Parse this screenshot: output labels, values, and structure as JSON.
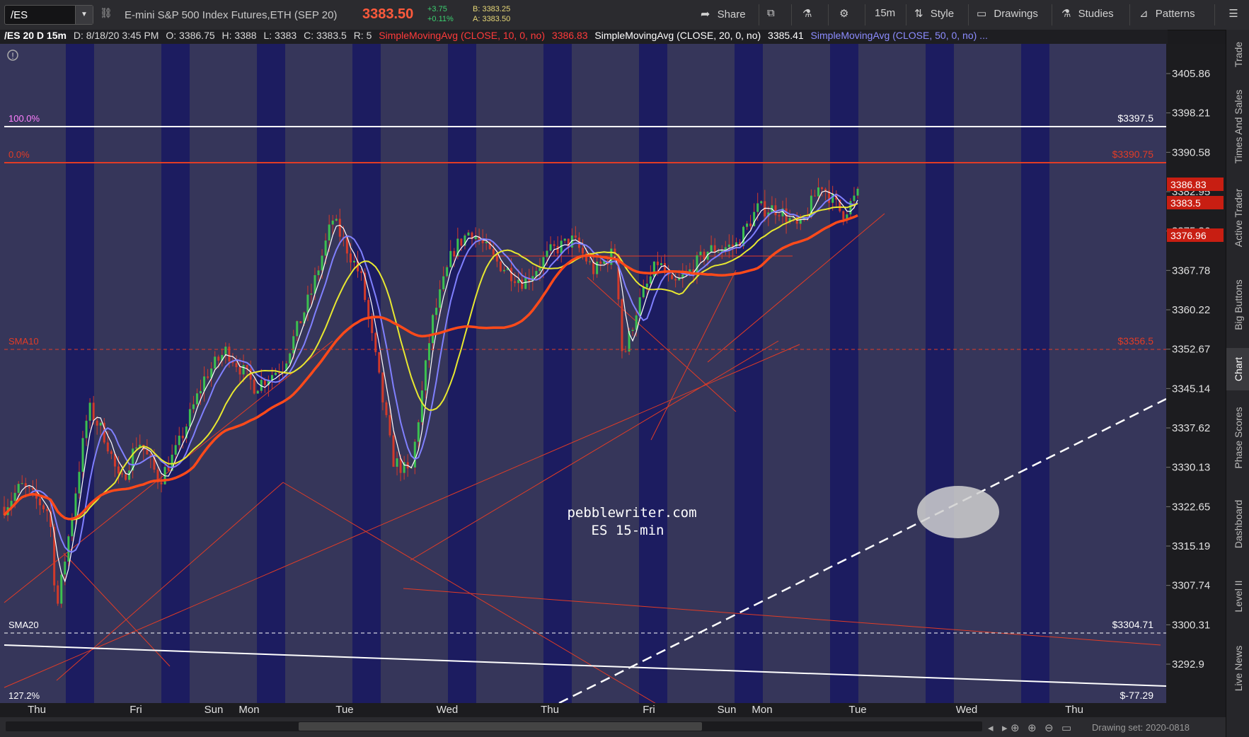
{
  "toolbar": {
    "symbol": "/ES",
    "title": "E-mini S&P 500 Index Futures,ETH (SEP 20)",
    "last_price": "3383.50",
    "change": "+3.75",
    "change_pct": "+0.11%",
    "bid": "B: 3383.25",
    "ask": "A: 3383.50",
    "share": "Share",
    "timeframe": "15m",
    "style": "Style",
    "drawings": "Drawings",
    "studies": "Studies",
    "patterns": "Patterns"
  },
  "header": {
    "symbol_info": "/ES 20 D 15m",
    "date": "D: 8/18/20 3:45 PM",
    "open": "O: 3386.75",
    "high": "H: 3388",
    "low": "L: 3383",
    "close": "C: 3383.5",
    "range": "R: 5",
    "sma10_label": "SimpleMovingAvg (CLOSE, 10, 0, no)",
    "sma10_value": "3386.83",
    "sma20_label": "SimpleMovingAvg (CLOSE, 20, 0, no)",
    "sma20_value": "3385.41",
    "sma50_label": "SimpleMovingAvg (CLOSE, 50, 0, no) ..."
  },
  "colors": {
    "background": "#36365a",
    "session_band": "#1c1c60",
    "candle": "#d23a2a",
    "sma10": "#ffffff",
    "sma20": "#8080ff",
    "sma50": "#e8e830",
    "ema": "#ff4a1a",
    "fib_red": "#e23c26",
    "accent": "#ff5a3c"
  },
  "chart_labels": {
    "fib_100": "100.0%",
    "fib_100_price": "$3397.5",
    "fib_0": "0.0%",
    "fib_0_price": "$3390.75",
    "sma10_line": "SMA10",
    "sma10_line_price": "$3356.5",
    "sma20_line": "SMA20",
    "sma20_line_price": "$3304.71",
    "fib_127": "127.2%",
    "fib_127_price": "$-77.29",
    "watermark_1": "pebblewriter.com",
    "watermark_2": "ES 15-min"
  },
  "price_axis": {
    "ticks": [
      "3405.86",
      "3398.21",
      "3390.58",
      "3382.95",
      "3375.36",
      "3367.78",
      "3360.22",
      "3352.67",
      "3345.14",
      "3337.62",
      "3330.13",
      "3322.65",
      "3315.19",
      "3307.74",
      "3300.31",
      "3292.9"
    ],
    "badges": [
      "3386.83",
      "3383.5",
      "3376.96"
    ]
  },
  "time_axis": {
    "labels": [
      "Thu",
      "Fri",
      "Sun",
      "Mon",
      "Tue",
      "Wed",
      "Thu",
      "Fri",
      "Sun",
      "Mon",
      "Tue",
      "Wed",
      "Thu"
    ]
  },
  "right_tabs": [
    "Trade",
    "Times And Sales",
    "Active Trader",
    "Big Buttons",
    "Chart",
    "Phase Scores",
    "Dashboard",
    "Level II",
    "Live News"
  ],
  "footer": {
    "drawing_set": "Drawing set: 2020-0818"
  }
}
